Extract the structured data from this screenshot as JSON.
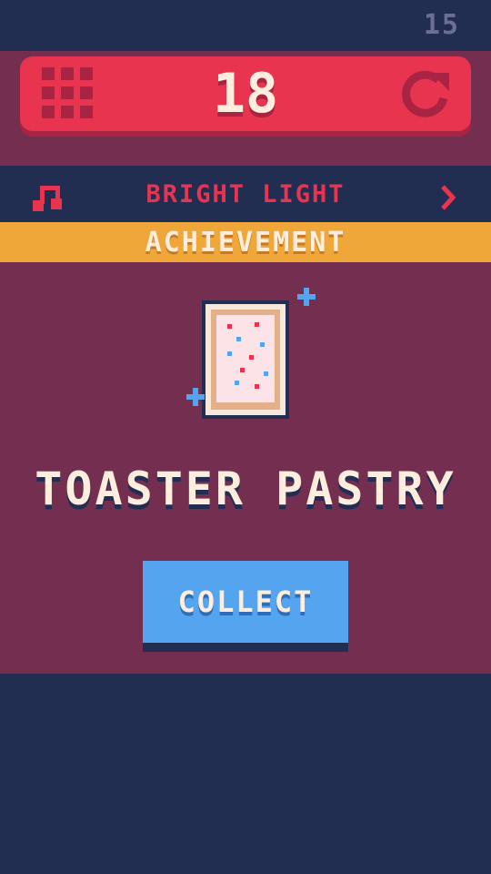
{
  "counter": "15",
  "topbar": {
    "level": "18",
    "track_name": "BRIGHT LIGHT",
    "icons": {
      "menu": "grid-icon",
      "restart": "restart-icon",
      "music": "music-note-icon",
      "next": "chevron-right-icon"
    }
  },
  "achievement": {
    "banner": "ACHIEVEMENT",
    "item_name": "TOASTER PASTRY",
    "item_icon": "toaster-pastry-icon",
    "collect_label": "COLLECT"
  },
  "colors": {
    "background": "#222d52",
    "panel": "#742f50",
    "accent_red": "#e8344e",
    "banner_orange": "#f0a73a",
    "button_blue": "#55a4ef",
    "text_cream": "#ffeedd"
  }
}
